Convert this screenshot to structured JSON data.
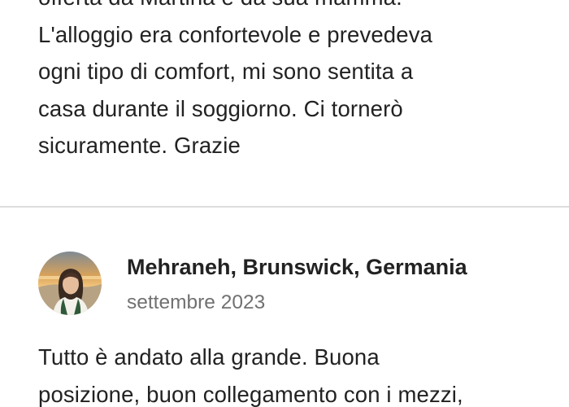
{
  "previous_review": {
    "lines": [
      "offerta da Martina e da sua mamma.",
      "L'alloggio era confortevole e prevedeva",
      "ogni tipo di comfort, mi sono sentita a",
      "casa durante il soggiorno. Ci tornerò",
      "sicuramente. Grazie"
    ]
  },
  "next_review": {
    "reviewer": "Mehraneh, Brunswick, Germania",
    "date": "settembre 2023",
    "avatar_icon": "user-photo-avatar",
    "lines": [
      "Tutto è andato alla grande. Buona",
      "posizione, buon collegamento con i mezzi,"
    ]
  },
  "colors": {
    "text": "#222222",
    "muted": "#717171",
    "divider": "#dddddd"
  }
}
